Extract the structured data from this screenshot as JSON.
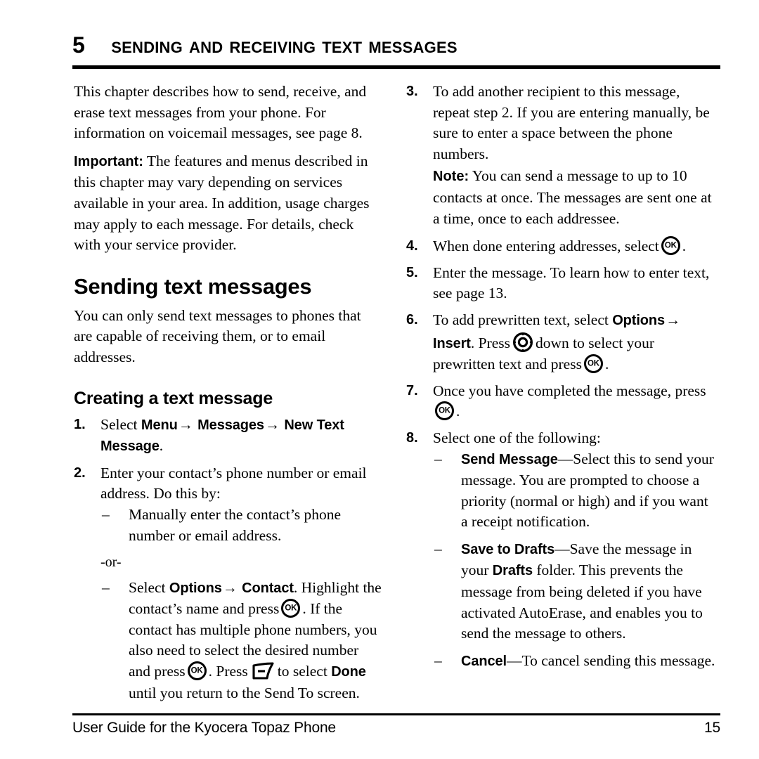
{
  "document": {
    "chapter_number": "5",
    "chapter_title": "Sending and Receiving Text Messages"
  },
  "left_column": {
    "intro_paragraph": "This chapter describes how to send, receive, and erase text messages from your phone. For information on voicemail messages, see page 8.",
    "important_label": "Important:",
    "important_text": "The features and menus described in this chapter may vary depending on services available in your area. In addition, usage charges may apply to each message. For details, check with your service provider.",
    "heading_section": "Sending text messages",
    "section_paragraph": "You can only send text messages to phones that are capable of receiving them, or to email addresses.",
    "heading_subsection": "Creating a text message",
    "step1": {
      "number": "1.",
      "text_before": "Select",
      "menu_1": "Menu",
      "arrow_1": "→",
      "menu_2": "Messages",
      "arrow_2": "→",
      "menu_3": "New Text Message",
      "text_after": "."
    },
    "step2": {
      "number": "2.",
      "text": "Enter your contact’s phone number or email address. Do this by:",
      "bullet_1": "Manually enter the contact’s phone number or email address.",
      "or_separator": "-or-",
      "bullet_2": {
        "part_1": "Select",
        "menu_1": "Options",
        "arrow_1": "→",
        "menu_2": "Contact",
        "part_2": ". Highlight the contact’s name and press",
        "icon_1": "ok-key-icon",
        "part_3": ". If the contact has multiple phone numbers, you also need to select the desired number and press",
        "icon_2": "ok-key-icon",
        "part_4": ". Press",
        "icon_3": "softkey-icon",
        "part_5": "to select",
        "menu_3": "Done",
        "part_6": "until you return to the Send To screen."
      }
    }
  },
  "right_column": {
    "step3": {
      "number": "3.",
      "text": "To add another recipient to this message, repeat step 2. If you are entering manually, be sure to enter a space between the phone numbers.",
      "note_label": "Note:",
      "note_text": "You can send a message to up to 10 contacts at once. The messages are sent one at a time, once to each addressee."
    },
    "step4": {
      "number": "4.",
      "text_before": "When done entering addresses, select",
      "icon": "ok-key-icon",
      "text_after": "."
    },
    "step5": {
      "number": "5.",
      "text": "Enter the message. To learn how to enter text, see page 13."
    },
    "step6": {
      "number": "6.",
      "part_1": "To add prewritten text, select",
      "menu_1": "Options",
      "arrow_1": "→",
      "menu_2": "Insert",
      "part_2": ". Press",
      "icon_1": "navigation-key-icon",
      "part_3": "down to select your prewritten text and press",
      "icon_2": "ok-key-icon",
      "part_4": "."
    },
    "step7": {
      "number": "7.",
      "text_before": "Once you have completed the message, press",
      "icon": "ok-key-icon",
      "text_after": "."
    },
    "step8": {
      "number": "8.",
      "text": "Select one of the following:",
      "option_1": {
        "term": "Send Message",
        "dash": "—",
        "description": "Select this to send your message. You are prompted to choose a priority (normal or high) and if you want a receipt notification."
      },
      "option_2": {
        "term": "Save to Drafts",
        "dash": "—",
        "desc_part_1": "Save the message in your",
        "emphasis": "Drafts",
        "desc_part_2": "folder. This prevents the message from being deleted if you have activated AutoErase, and enables you to send the message to others."
      },
      "option_3": {
        "term": "Cancel",
        "dash": "—",
        "description": "To cancel sending this message."
      }
    }
  },
  "footer": {
    "guide_text": "User Guide for the Kyocera Topaz Phone",
    "page_number": "15"
  },
  "bullets": {
    "dash": "–"
  },
  "colors": {
    "text": "#000000",
    "background": "#ffffff",
    "rule": "#000000"
  }
}
